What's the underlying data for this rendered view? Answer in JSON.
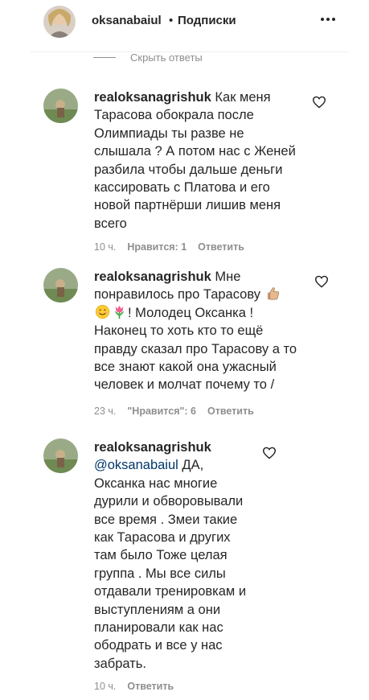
{
  "header": {
    "username": "oksanabaiul",
    "separator": "•",
    "follow_label": "Подписки"
  },
  "hide_replies": "Скрыть ответы",
  "comments": [
    {
      "username": "realoksanagrishuk",
      "lines": [
        "Как меня",
        "Тарасова обокрала после",
        "Олимпиады ты разве не",
        "слышала ? А потом нас с Женей",
        "разбила чтобы дальше деньги",
        "кассировать с Платова и его",
        "новой партнёрши лишив меня",
        "всего"
      ],
      "time": "10 ч.",
      "likes": "Нравится: 1",
      "reply": "Ответить"
    },
    {
      "username": "realoksanagrishuk",
      "lines": [
        "Мне",
        "понравилось про Тарасову",
        "! Молодец Оксанка !",
        "Наконец то хоть кто то ещё",
        "правду сказал про Тарасову а то",
        "все знают какой она ужасный",
        "человек и молчат почему то /"
      ],
      "emojis": [
        "thumbs-up-emoji",
        "smiling-emoji",
        "tulip-emoji"
      ],
      "time": "23 ч.",
      "likes": "\"Нравится\": 6",
      "reply": "Ответить"
    },
    {
      "username": "realoksanagrishuk",
      "mention": "@oksanabaiul",
      "lines": [
        "ДА,",
        "Оксанка нас многие",
        "дурили и обворовывали",
        "все время . Змеи такие",
        "как Тарасова и других",
        "там было Тоже целая",
        "группа . Мы все силы",
        "отдавали тренировкам и",
        "выступлениям а они",
        "планировали как нас",
        "ободрать и все у нас",
        "забрать."
      ],
      "time": "10 ч.",
      "reply": "Ответить"
    }
  ],
  "colors": {
    "text": "#262626",
    "muted": "#8e8e8e",
    "mention": "#00376b"
  }
}
